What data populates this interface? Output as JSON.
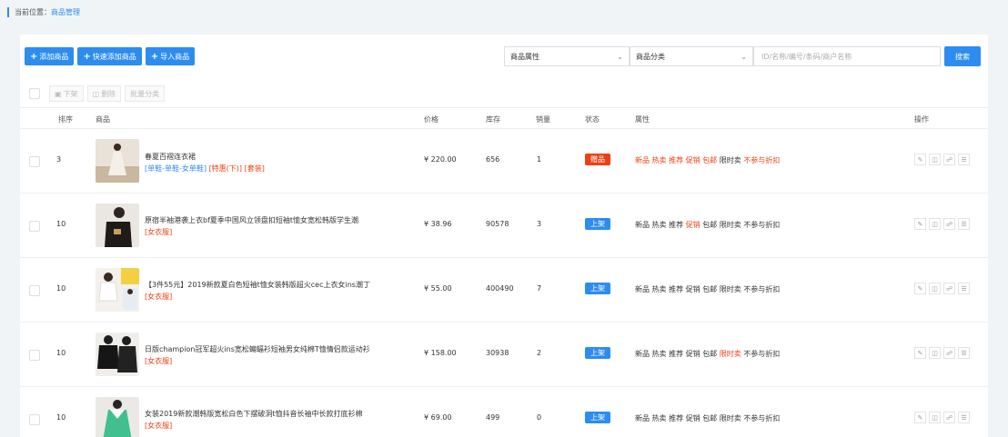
{
  "breadcrumb": {
    "prefix": "当前位置：",
    "current": "商品管理"
  },
  "toolbar": {
    "add": "添加商品",
    "quick_add": "快速添加商品",
    "import": "导入商品"
  },
  "filters": {
    "attr_select": "商品属性",
    "category_select": "商品分类",
    "search_placeholder": "ID/名称/编号/条码/商户名称",
    "search_button": "搜索"
  },
  "batch": {
    "off_shelf": "下架",
    "delete": "删除",
    "batch_category": "批量分类"
  },
  "columns": {
    "sort": "排序",
    "product": "商品",
    "price": "价格",
    "stock": "库存",
    "sales": "销量",
    "status": "状态",
    "attrs": "属性",
    "ops": "操作"
  },
  "colors": {
    "accent": "#2d8cf0",
    "gift": "#ed4014",
    "on_shelf": "#2d8cf0"
  },
  "rows": [
    {
      "sort": "3",
      "name": "春夏百褶连衣裙",
      "tags": [
        {
          "text": "[单鞋-单鞋-女单鞋]",
          "color": "blue"
        },
        {
          "text": "[特惠(下)]",
          "color": "red"
        },
        {
          "text": "[套装]",
          "color": "red"
        }
      ],
      "price": "¥ 220.00",
      "stock": "656",
      "sales": "1",
      "status": "赠品",
      "status_color": "#ed4014",
      "attrs": [
        {
          "t": "新品",
          "on": true
        },
        {
          "t": "热卖",
          "on": true
        },
        {
          "t": "推荐",
          "on": true
        },
        {
          "t": "促销",
          "on": true
        },
        {
          "t": "包邮",
          "on": true
        },
        {
          "t": "限时卖",
          "on": false
        },
        {
          "t": "不参与折扣",
          "on": true
        }
      ]
    },
    {
      "sort": "10",
      "name": "原宿半袖港袭上衣bf夏季中国风立领盘扣短袖t恤女宽松韩版学生潮",
      "tags": [
        {
          "text": "[女衣服]",
          "color": "red"
        }
      ],
      "price": "¥ 38.96",
      "stock": "90578",
      "sales": "3",
      "status": "上架",
      "status_color": "#2d8cf0",
      "attrs": [
        {
          "t": "新品",
          "on": false
        },
        {
          "t": "热卖",
          "on": false
        },
        {
          "t": "推荐",
          "on": false
        },
        {
          "t": "促销",
          "on": true
        },
        {
          "t": "包邮",
          "on": false
        },
        {
          "t": "限时卖",
          "on": false
        },
        {
          "t": "不参与折扣",
          "on": false
        }
      ]
    },
    {
      "sort": "10",
      "name": "【3件55元】2019新款夏白色短袖t恤女装韩版超火cec上衣女ins潮丁",
      "tags": [
        {
          "text": "[女衣服]",
          "color": "red"
        }
      ],
      "price": "¥ 55.00",
      "stock": "400490",
      "sales": "7",
      "status": "上架",
      "status_color": "#2d8cf0",
      "attrs": [
        {
          "t": "新品",
          "on": false
        },
        {
          "t": "热卖",
          "on": false
        },
        {
          "t": "推荐",
          "on": false
        },
        {
          "t": "促销",
          "on": false
        },
        {
          "t": "包邮",
          "on": false
        },
        {
          "t": "限时卖",
          "on": false
        },
        {
          "t": "不参与折扣",
          "on": false
        }
      ]
    },
    {
      "sort": "10",
      "name": "日版champion冠军超火ins宽松蝙蝠衫短袖男女纯棉T恤情侣款运动衫",
      "tags": [
        {
          "text": "[女衣服]",
          "color": "red"
        }
      ],
      "price": "¥ 158.00",
      "stock": "30938",
      "sales": "2",
      "status": "上架",
      "status_color": "#2d8cf0",
      "attrs": [
        {
          "t": "新品",
          "on": false
        },
        {
          "t": "热卖",
          "on": false
        },
        {
          "t": "推荐",
          "on": false
        },
        {
          "t": "促销",
          "on": false
        },
        {
          "t": "包邮",
          "on": false
        },
        {
          "t": "限时卖",
          "on": true
        },
        {
          "t": "不参与折扣",
          "on": false
        }
      ]
    },
    {
      "sort": "10",
      "name": "女装2019新款潮韩版宽松白色下摆破洞t恤抖音长袖中长款打底衫棉",
      "tags": [
        {
          "text": "[女衣服]",
          "color": "red"
        }
      ],
      "price": "¥ 69.00",
      "stock": "499",
      "sales": "0",
      "status": "上架",
      "status_color": "#2d8cf0",
      "attrs": [
        {
          "t": "新品",
          "on": false
        },
        {
          "t": "热卖",
          "on": false
        },
        {
          "t": "推荐",
          "on": false
        },
        {
          "t": "促销",
          "on": false
        },
        {
          "t": "包邮",
          "on": false
        },
        {
          "t": "限时卖",
          "on": false
        },
        {
          "t": "不参与折扣",
          "on": false
        }
      ]
    }
  ]
}
